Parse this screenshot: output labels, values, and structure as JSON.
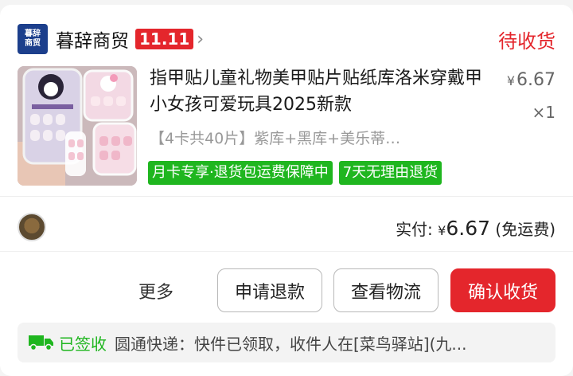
{
  "shop": {
    "logo_line1": "暮辞",
    "logo_line2": "商贸",
    "name": "暮辞商贸",
    "promo_badge": "11.11",
    "chevron": "›",
    "status": "待收货",
    "accent_color": "#e4262c"
  },
  "product": {
    "title": "指甲贴儿童礼物美甲贴片贴纸库洛米穿戴甲小女孩可爱玩具2025新款",
    "price_symbol": "¥",
    "price": "6.67",
    "quantity": "×1",
    "sku": "【4卡共40片】紫库+黑库+美乐蒂…",
    "tags": [
      "月卡专享·退货包运费保障中",
      "7天无理由退货"
    ],
    "tag_color": "#1fb61f",
    "thumbnail_icon": "product-thumbnail"
  },
  "payment": {
    "label": "实付:",
    "symbol": "¥",
    "amount": "6.67",
    "note": "(免运费)"
  },
  "actions": {
    "more": "更多",
    "refund": "申请退款",
    "logistics": "查看物流",
    "confirm": "确认收货"
  },
  "logistics": {
    "icon": "truck-icon",
    "status": "已签收",
    "detail": "圆通快递：快件已领取，收件人在[菜鸟驿站](九..."
  }
}
